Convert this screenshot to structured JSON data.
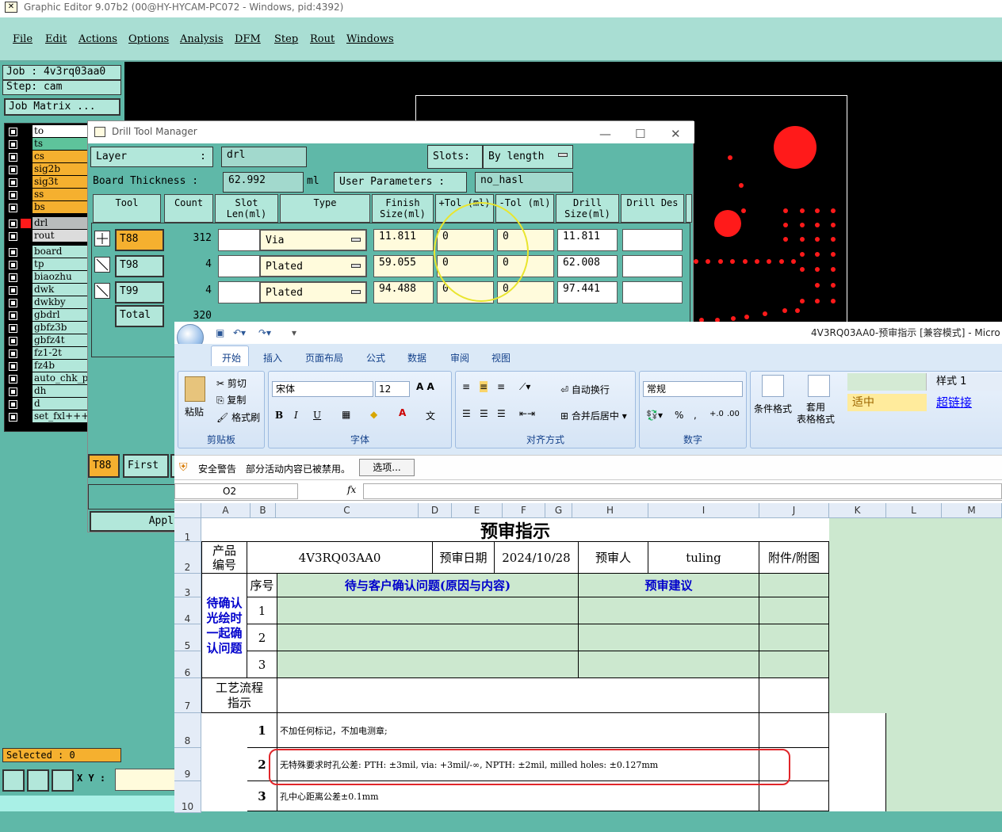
{
  "editor": {
    "title": "Graphic Editor 9.07b2 (00@HY-HYCAM-PC072 - Windows, pid:4392)",
    "menu": [
      "File",
      "Edit",
      "Actions",
      "Options",
      "Analysis",
      "DFM",
      "Step",
      "Rout",
      "Windows"
    ],
    "job": "Job : 4v3rq03aa0",
    "step": "Step: cam",
    "job_matrix": "Job Matrix ...",
    "layers": [
      "to",
      "ts",
      "cs",
      "sig2b",
      "sig3t",
      "ss",
      "bs",
      "drl",
      "rout",
      "board",
      "tp",
      "biaozhu",
      "dwk",
      "dwkby",
      "gbdrl",
      "gbfz3b",
      "gbfz4t",
      "fz1-2t",
      "fz4b",
      "auto_chk_p",
      "dh",
      "d",
      "set_fxl+++"
    ],
    "selected": "Selected : 0",
    "xy_label": "X Y :"
  },
  "drill_manager": {
    "title": "Drill Tool Manager",
    "layer_label": "Layer",
    "layer_value": "drl",
    "slots_label": "Slots:",
    "slots_value": "By length",
    "board_thickness_label": "Board Thickness :",
    "board_thickness_value": "62.992",
    "board_thickness_unit": "ml",
    "user_params_label": "User Parameters :",
    "user_params_value": "no_hasl",
    "headers": [
      "Tool",
      "Count",
      "Slot Len(ml)",
      "Type",
      "Finish Size(ml)",
      "+Tol (ml)",
      "-Tol (ml)",
      "Drill Size(ml)",
      "Drill Des"
    ],
    "rows": [
      {
        "tool": "T88",
        "count": "312",
        "type": "Via",
        "finish": "11.811",
        "ptol": "0",
        "ntol": "0",
        "drill": "11.811"
      },
      {
        "tool": "T98",
        "count": "4",
        "type": "Plated",
        "finish": "59.055",
        "ptol": "0",
        "ntol": "0",
        "drill": "62.008"
      },
      {
        "tool": "T99",
        "count": "4",
        "type": "Plated",
        "finish": "94.488",
        "ptol": "0",
        "ntol": "0",
        "drill": "97.441"
      }
    ],
    "total_label": "Total",
    "total_value": "320",
    "current_tool": "T88",
    "first_button": "First",
    "apply_button": "Appl"
  },
  "excel": {
    "title": "4V3RQ03AA0-预审指示  [兼容模式] - Micro",
    "tabs": [
      "开始",
      "插入",
      "页面布局",
      "公式",
      "数据",
      "审阅",
      "视图"
    ],
    "clipboard": {
      "paste": "粘贴",
      "cut": "剪切",
      "copy": "复制",
      "format_painter": "格式刷",
      "group": "剪贴板"
    },
    "font": {
      "name": "宋体",
      "size": "12",
      "group": "字体"
    },
    "alignment": {
      "wrap": "自动换行",
      "merge": "合并后居中",
      "group": "对齐方式"
    },
    "number": {
      "format": "常规",
      "group": "数字"
    },
    "styles": {
      "conditional": "条件格式",
      "table_format": "套用\n表格格式",
      "style1": "样式 1",
      "neutral": "适中",
      "hyperlink": "超链接"
    },
    "security_warning": "安全警告",
    "security_msg": "部分活动内容已被禁用。",
    "options_button": "选项...",
    "name_box": "O2",
    "fx": "fx",
    "columns": [
      "A",
      "B",
      "C",
      "D",
      "E",
      "F",
      "G",
      "H",
      "I",
      "J",
      "K",
      "L",
      "M"
    ],
    "rows": [
      "1",
      "2",
      "3",
      "4",
      "5",
      "6",
      "7",
      "8",
      "9",
      "10"
    ],
    "sheet": {
      "title": "预审指示",
      "product_label": "产品\n编号",
      "product_value": "4V3RQ03AA0",
      "date_label": "预审日期",
      "date_value": "2024/10/28",
      "reviewer_label": "预审人",
      "reviewer_value": "tuling",
      "attach_label": "附件/附图",
      "seq_label": "序号",
      "issue_label": "待与客户确认问题(原因与内容)",
      "suggest_label": "预审建议",
      "confirm_label": "待确认\n光绘时\n一起确\n认问题",
      "seq": [
        "1",
        "2",
        "3"
      ],
      "process_label": "工艺流程\n指示",
      "instructions": [
        {
          "n": "1",
          "text": "不加任何标记，不加电测章;"
        },
        {
          "n": "2",
          "text": "无特殊要求时孔公差: PTH: ±3mil, via: +3mil/-∞, NPTH: ±2mil, milled holes: ±0.127mm"
        },
        {
          "n": "3",
          "text": "孔中心距离公差±0.1mm"
        }
      ]
    }
  }
}
